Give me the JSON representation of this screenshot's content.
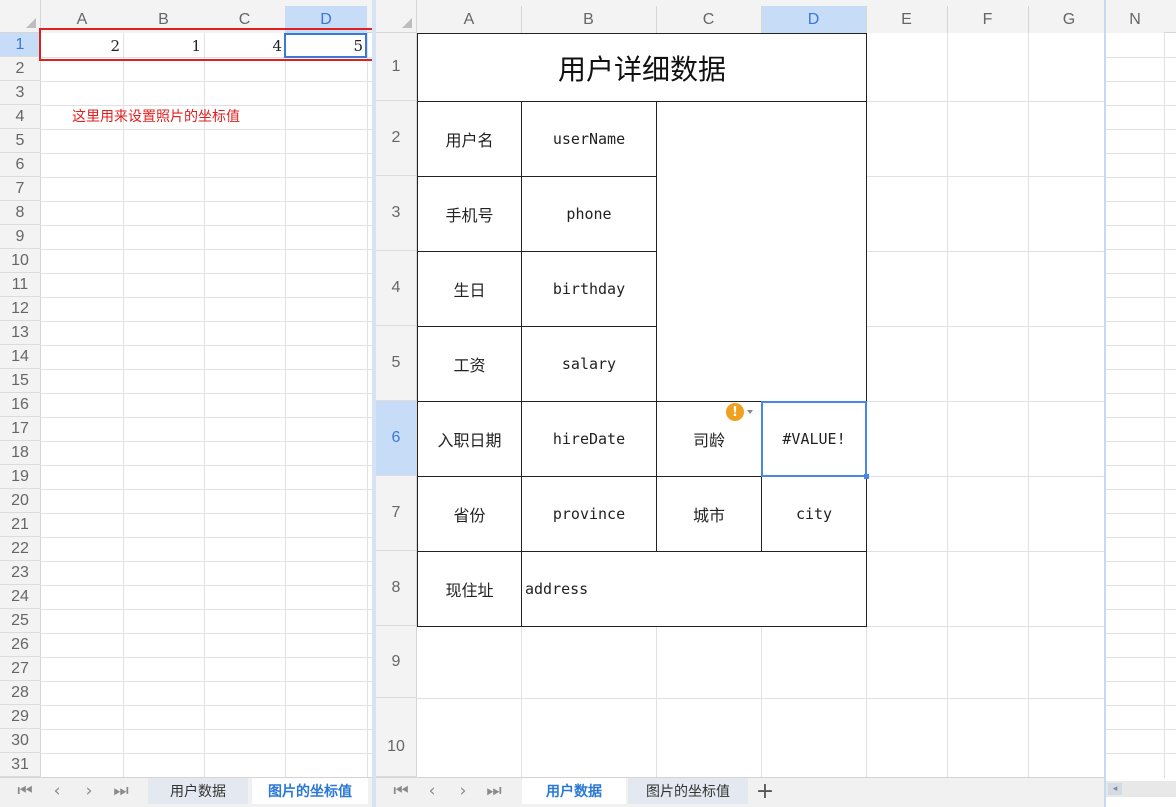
{
  "left_sheet": {
    "columns": [
      "A",
      "B",
      "C",
      "D"
    ],
    "selected_column": "D",
    "rows": [
      "1",
      "2",
      "3",
      "4",
      "5",
      "6",
      "7",
      "8",
      "9",
      "10",
      "11",
      "12",
      "13",
      "14",
      "15",
      "16",
      "17",
      "18",
      "19",
      "20",
      "21",
      "22",
      "23",
      "24",
      "25",
      "26",
      "27",
      "28",
      "29",
      "30",
      "31"
    ],
    "row1_values": [
      "2",
      "1",
      "4",
      "5"
    ],
    "note": "这里用来设置照片的坐标值",
    "note_color": "#e02020",
    "highlight_color": "#e02020",
    "tabs": [
      "用户数据",
      "图片的坐标值"
    ],
    "active_tab": "图片的坐标值"
  },
  "right_sheet": {
    "columns": [
      "A",
      "B",
      "C",
      "D",
      "E",
      "F",
      "G"
    ],
    "far_column": "N",
    "selected_column": "D",
    "rows": [
      "1",
      "2",
      "3",
      "4",
      "5",
      "6",
      "7",
      "8",
      "9",
      "10"
    ],
    "selected_row": "6",
    "title": "用户详细数据",
    "labels": {
      "username": "用户名",
      "phone": "手机号",
      "birthday": "生日",
      "salary": "工资",
      "hiredate": "入职日期",
      "seniority": "司龄",
      "province": "省份",
      "city": "城市",
      "address": "现住址"
    },
    "fields": {
      "username": "userName",
      "phone": "phone",
      "birthday": "birthday",
      "salary": "salary",
      "hiredate": "hireDate",
      "seniority_value": "#VALUE!",
      "province": "province",
      "city": "city",
      "address": "address"
    },
    "warning_icon": "exclamation-circle-icon",
    "warning_color": "#f0a020",
    "tabs": [
      "用户数据",
      "图片的坐标值"
    ],
    "active_tab": "用户数据",
    "add_sheet_symbol": "+",
    "accent_color": "#2b79d6"
  },
  "nav_icons": [
    "first-sheet-icon",
    "prev-sheet-icon",
    "next-sheet-icon",
    "last-sheet-icon"
  ]
}
